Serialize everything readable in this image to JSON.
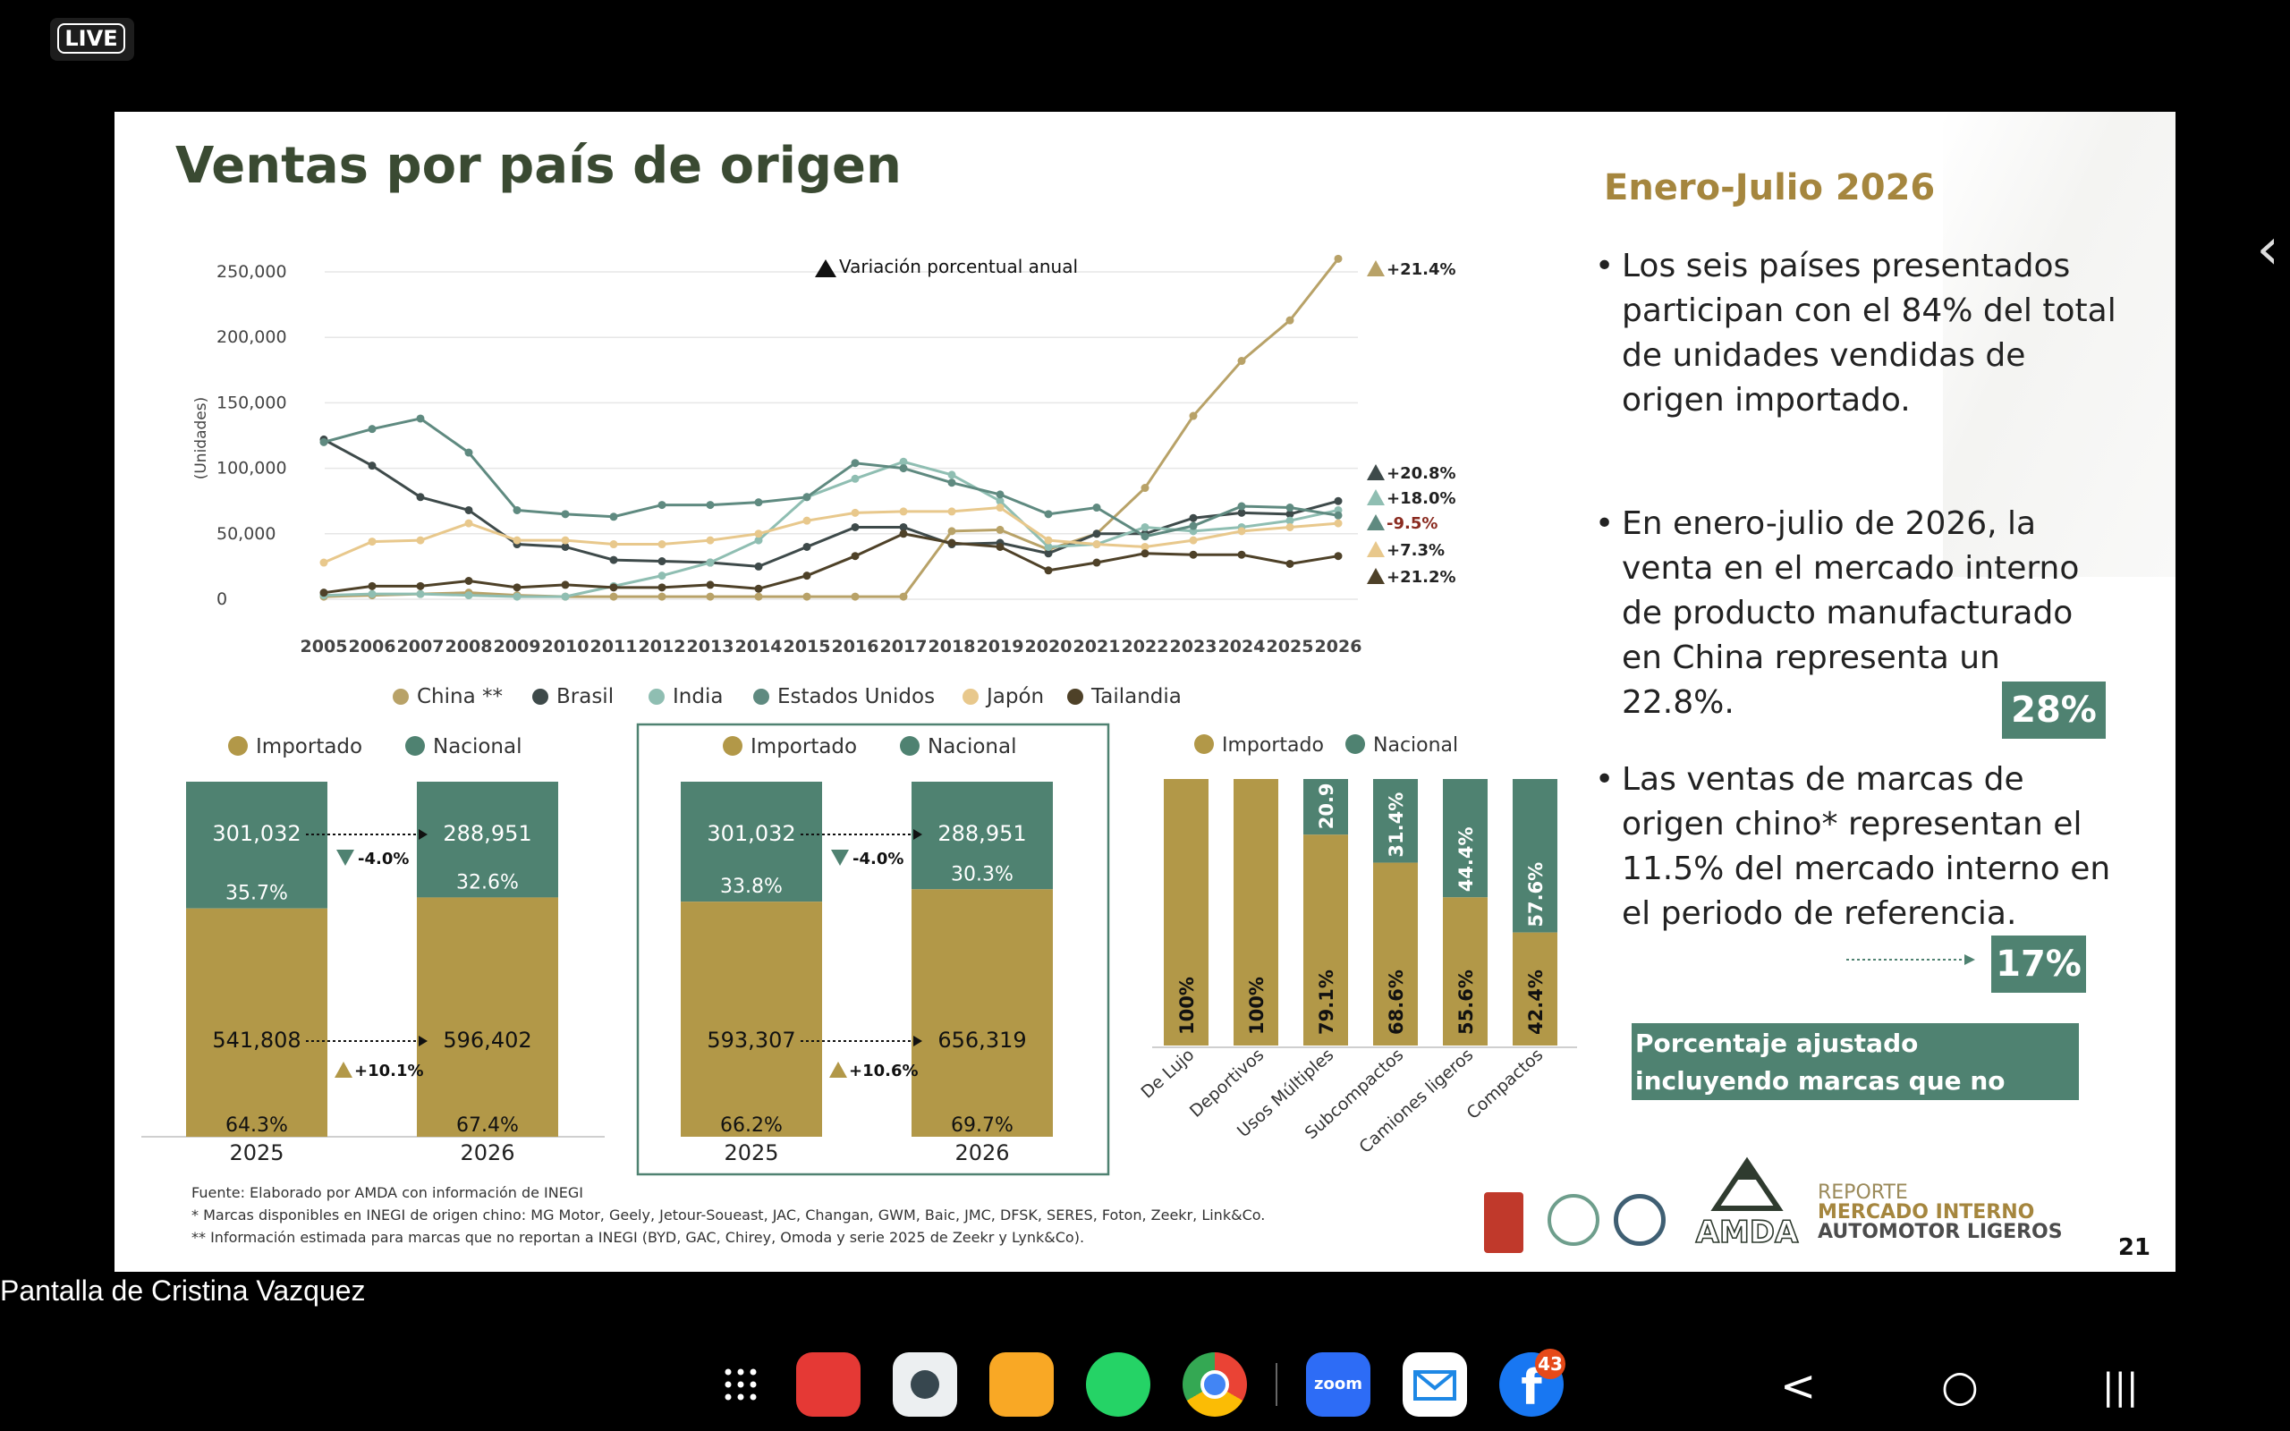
{
  "live_label": "LIVE",
  "presenter_label": "Pantalla de Cristina Vazquez",
  "slide": {
    "title": "Ventas por país de origen",
    "number": "21",
    "right_title": "Enero-Julio 2026",
    "bullets": [
      "Los seis países presentados participan con el 84% del total de unidades vendidas de origen importado.",
      "En enero-julio de 2026, la venta en el mercado interno de producto manufacturado en China representa un 22.8%.",
      "Las ventas de marcas de origen chino* representan el 11.5% del mercado interno en el periodo de referencia."
    ],
    "pct_28": "28%",
    "pct_17": "17%",
    "note_box": "Porcentaje ajustado incluyendo marcas que no reportan",
    "footnotes": [
      "Fuente: Elaborado por AMDA con información de INEGI",
      "* Marcas disponibles en INEGI de origen chino: MG Motor, Geely, Jetour-Soueast, JAC, Changan, GWM, Baic, JMC, DFSK, SERES, Foton, Zeekr, Link&Co.",
      "** Información estimada para marcas que no reportan a INEGI (BYD, GAC, Chirey, Omoda y serie 2025 de Zeekr y Lynk&Co)."
    ],
    "report_line1": "REPORTE",
    "report_line2": "MERCADO INTERNO",
    "report_line3": "AUTOMOTOR LIGEROS",
    "logo_text": "AMDA"
  },
  "colors": {
    "gold": "#b29848",
    "green": "#4f8271",
    "dark_green": "#3a4a32",
    "china": "#b8a268",
    "brasil": "#3e4a4a",
    "india": "#8fbeb2",
    "eua": "#5f8a80",
    "japon": "#e8c88c",
    "tailandia": "#4e4128"
  },
  "chart_data": [
    {
      "type": "line",
      "ylabel": "(Unidades)",
      "annotation": "Variación porcentual anual",
      "x": [
        "2005",
        "2006",
        "2007",
        "2008",
        "2009",
        "2010",
        "2011",
        "2012",
        "2013",
        "2014",
        "2015",
        "2016",
        "2017",
        "2018",
        "2019",
        "2020",
        "2021",
        "2022",
        "2023",
        "2024",
        "2025",
        "2026"
      ],
      "y_ticks": [
        "250,000",
        "200,000",
        "150,000",
        "100,000",
        "50,000",
        "0"
      ],
      "ylim": [
        0,
        250000
      ],
      "series": [
        {
          "name": "China **",
          "color": "#b8a268",
          "change": "+21.4%",
          "values": [
            2000,
            3000,
            4000,
            5000,
            3000,
            2000,
            2000,
            2000,
            2000,
            2000,
            2000,
            2000,
            2000,
            52000,
            53000,
            38000,
            50000,
            85000,
            140000,
            182000,
            213000,
            260000
          ]
        },
        {
          "name": "Brasil",
          "color": "#3e4a4a",
          "change": "+20.8%",
          "values": [
            122000,
            102000,
            78000,
            68000,
            42000,
            40000,
            30000,
            29000,
            28000,
            25000,
            40000,
            55000,
            55000,
            42000,
            43000,
            35000,
            50000,
            50000,
            62000,
            66000,
            65000,
            75000
          ]
        },
        {
          "name": "India",
          "color": "#8fbeb2",
          "change": "+18.0%",
          "values": [
            3000,
            4000,
            4000,
            3000,
            2000,
            2000,
            10000,
            18000,
            28000,
            45000,
            78000,
            92000,
            105000,
            95000,
            75000,
            40000,
            42000,
            55000,
            52000,
            55000,
            60000,
            68000
          ]
        },
        {
          "name": "Estados Unidos",
          "color": "#5f8a80",
          "change": "-9.5%",
          "values": [
            120000,
            130000,
            138000,
            112000,
            68000,
            65000,
            63000,
            72000,
            72000,
            74000,
            78000,
            104000,
            100000,
            89000,
            80000,
            65000,
            70000,
            48000,
            56000,
            71000,
            70000,
            64000
          ]
        },
        {
          "name": "Japón",
          "color": "#e8c88c",
          "change": "+7.3%",
          "values": [
            28000,
            44000,
            45000,
            58000,
            45000,
            45000,
            42000,
            42000,
            45000,
            50000,
            60000,
            66000,
            67000,
            67000,
            70000,
            45000,
            42000,
            40000,
            45000,
            52000,
            55000,
            58000
          ]
        },
        {
          "name": "Tailandia",
          "color": "#4e4128",
          "change": "+21.2%",
          "values": [
            5000,
            10000,
            10000,
            14000,
            9000,
            11000,
            9000,
            9000,
            11000,
            8000,
            18000,
            33000,
            50000,
            43000,
            40000,
            22000,
            28000,
            35000,
            34000,
            34000,
            27000,
            33000
          ]
        }
      ],
      "legend": "bottom"
    },
    {
      "type": "bar",
      "stacked": true,
      "legend": [
        "Importado",
        "Nacional"
      ],
      "categories": [
        "2025",
        "2026"
      ],
      "importado": {
        "units": [
          "541,808",
          "596,402"
        ],
        "pct": [
          "64.3%",
          "67.4%"
        ],
        "values": [
          64.3,
          67.4
        ]
      },
      "nacional": {
        "units": [
          "301,032",
          "288,951"
        ],
        "pct": [
          "35.7%",
          "32.6%"
        ],
        "values": [
          35.7,
          32.6
        ]
      },
      "change_importado": "+10.1%",
      "change_nacional": "-4.0%"
    },
    {
      "type": "bar",
      "stacked": true,
      "legend": [
        "Importado",
        "Nacional"
      ],
      "categories": [
        "2025",
        "2026"
      ],
      "importado": {
        "units": [
          "593,307",
          "656,319"
        ],
        "pct": [
          "66.2%",
          "69.7%"
        ],
        "values": [
          66.2,
          69.7
        ]
      },
      "nacional": {
        "units": [
          "301,032",
          "288,951"
        ],
        "pct": [
          "33.8%",
          "30.3%"
        ],
        "values": [
          33.8,
          30.3
        ]
      },
      "change_importado": "+10.6%",
      "change_nacional": "-4.0%"
    },
    {
      "type": "bar",
      "stacked": true,
      "legend": [
        "Importado",
        "Nacional"
      ],
      "categories": [
        "De Lujo",
        "Deportivos",
        "Usos Múltiples",
        "Subcompactos",
        "Camiones ligeros",
        "Compactos"
      ],
      "importado": {
        "values": [
          100,
          100,
          79.1,
          68.6,
          55.6,
          42.4
        ],
        "labels": [
          "100%",
          "100%",
          "79.1%",
          "68.6%",
          "55.6%",
          "42.4%"
        ]
      },
      "nacional": {
        "values": [
          0,
          0,
          20.9,
          31.4,
          44.4,
          57.6
        ],
        "labels": [
          "",
          "",
          "20.9",
          "31.4%",
          "44.4%",
          "57.6%"
        ]
      }
    }
  ],
  "dock": {
    "zoom_label": "zoom",
    "facebook_badge": "43",
    "back_label": "<",
    "home_label": "○",
    "recents_label": "|||"
  }
}
